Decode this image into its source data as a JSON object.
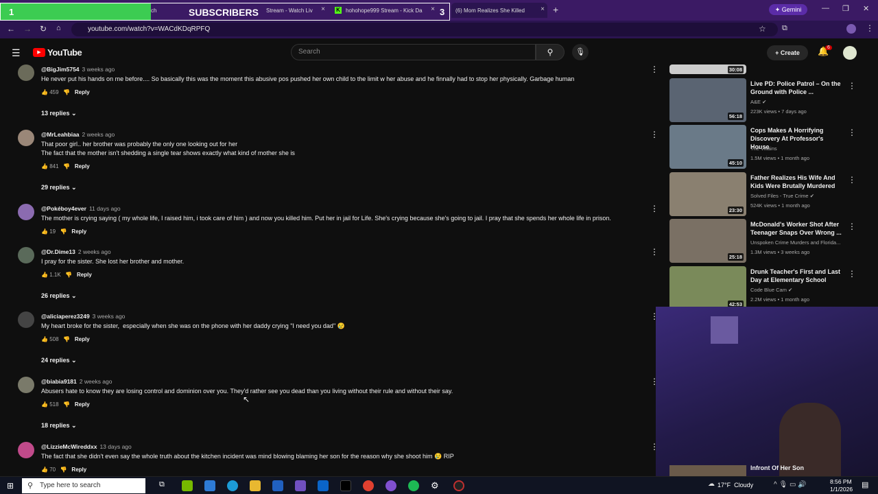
{
  "browser": {
    "tabs": [
      {
        "label": "ch",
        "close": "×"
      },
      {
        "label": "Stream - Watch Liv",
        "close": "×"
      },
      {
        "label": "hohohope999 Stream - Kick Da",
        "close": "×"
      },
      {
        "label": "(6) Mom Realizes She Killed",
        "close": "×"
      }
    ],
    "new_tab": "+",
    "gemini": "Gemini",
    "url": "youtube.com/watch?v=WACdKDqRPFQ"
  },
  "overlay": {
    "left_number": "1",
    "title": "SUBSCRIBERS",
    "right_number": "3"
  },
  "youtube": {
    "logo": "YouTube",
    "search_placeholder": "Search",
    "create": "Create",
    "notif_count": "6",
    "comments": [
      {
        "author": "@BigJim5754",
        "time": "3 weeks ago",
        "text": "He never put his hands on me before.... So basically this was the moment this abusive pos pushed her own child to the limit w her abuse and he finnally had to stop her physically. Garbage human",
        "likes": "459",
        "reply": "Reply",
        "replies": "13 replies"
      },
      {
        "author": "@MrLeahbiaa",
        "time": "2 weeks ago",
        "text": "That poor girl.. her brother was probably the only one looking out for her\nThe fact that the mother isn't shedding a single tear shows exactly what kind of mother she is",
        "likes": "841",
        "reply": "Reply",
        "replies": "29 replies"
      },
      {
        "author": "@Pokéboy4ever",
        "time": "11 days ago",
        "text": "The mother is crying saying ( my whole life, I raised him, i took care of him ) and now you killed him. Put her in jail for Life. She's crying because she's going to jail. I pray that she spends her whole life in prison.",
        "likes": "19",
        "reply": "Reply",
        "replies": ""
      },
      {
        "author": "@Dr.Dime13",
        "time": "2 weeks ago",
        "text": "I pray for the sister. She lost her brother and mother.",
        "likes": "1.1K",
        "reply": "Reply",
        "replies": "26 replies"
      },
      {
        "author": "@aliciaperez3249",
        "time": "3 weeks ago",
        "text": "My heart broke for the sister,  especially when she was on the phone with her daddy crying \"I need you dad\" 😢",
        "likes": "508",
        "reply": "Reply",
        "replies": "24 replies"
      },
      {
        "author": "@biabia9181",
        "time": "2 weeks ago",
        "text": "Abusers hate to know they are losing control and dominion over you. They'd rather see you dead than you living without their rule and without their say.",
        "likes": "518",
        "reply": "Reply",
        "replies": "18 replies"
      },
      {
        "author": "@LizzieMcWireddxx",
        "time": "13 days ago",
        "text": "The fact that she didn't even say the whole truth about the kitchen incident was mind blowing blaming her son for the reason why she shoot him 😢 RIP",
        "likes": "70",
        "reply": "Reply",
        "replies": ""
      }
    ],
    "sidebar": [
      {
        "title": "",
        "channel": "",
        "views": "",
        "duration": "30:08"
      },
      {
        "title": "Live PD: Police Patrol – On the Ground with Police ...",
        "channel": "A&E",
        "views": "223K views • 7 days ago",
        "duration": "56:18"
      },
      {
        "title": "Cops Makes A Horrifying Discovery At Professor's House",
        "channel": "The Villains",
        "views": "1.5M views • 1 month ago",
        "duration": "45:10"
      },
      {
        "title": "Father Realizes His Wife And Kids Were Brutally Murdered",
        "channel": "Solved Files - True Crime",
        "views": "524K views • 1 month ago",
        "duration": "23:30"
      },
      {
        "title": "McDonald's Worker Shot After Teenager Snaps Over Wrong ...",
        "channel": "Unspoken Crime Murders  and Florida...",
        "views": "1.3M views • 3 weeks ago",
        "duration": "25:18"
      },
      {
        "title": "Drunk Teacher's First and Last Day at Elementary School",
        "channel": "Code Blue Cam",
        "views": "2.2M views • 1 month ago",
        "duration": "42:53"
      },
      {
        "title": "Infront Of Her Son",
        "channel": "",
        "views": "",
        "duration": ""
      }
    ]
  },
  "taskbar": {
    "search_placeholder": "Type here to search",
    "weather": "17°F  Cloudy",
    "time": "8:56 PM",
    "date": "1/1/2026"
  }
}
